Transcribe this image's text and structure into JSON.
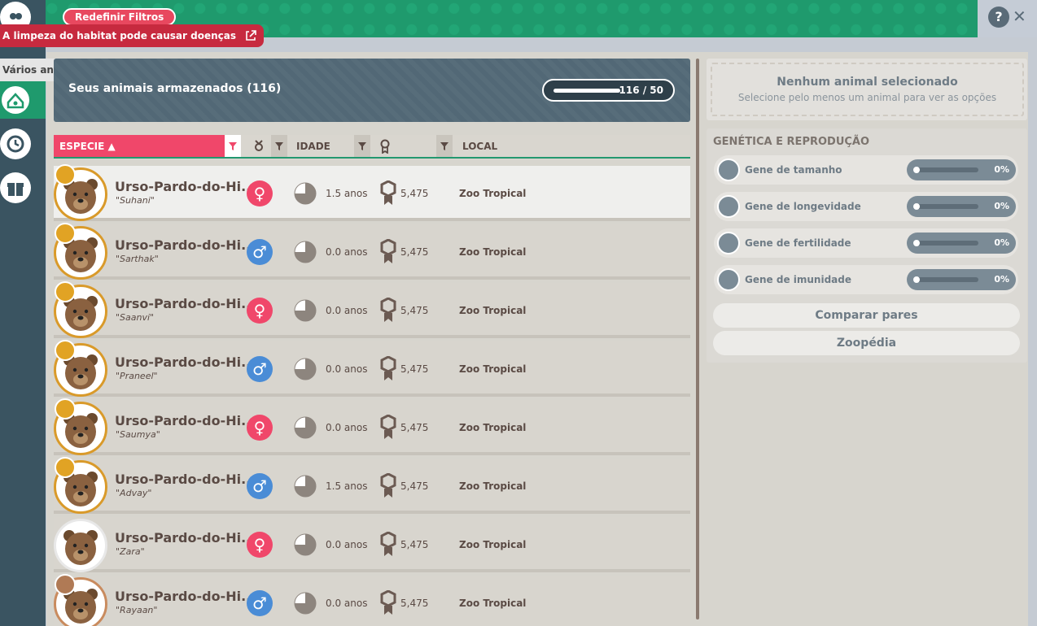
{
  "toolbar": {
    "reset_filters": "Redefinir Filtros",
    "help": "?",
    "close": "✕"
  },
  "notifications": [
    {
      "text": "A limpeza do habitat pode causar doenças",
      "icon": "external-link-icon",
      "severity": "alert"
    },
    {
      "text": "Vários animais estão com bem-estar baixo",
      "icon": "external-link-icon",
      "severity": "info"
    }
  ],
  "storage": {
    "title": "Seus animais armazenados (116)",
    "capacity": "116 / 50"
  },
  "columns": {
    "species": "ESPECIE ▲",
    "age": "IDADE",
    "location": "LOCAL"
  },
  "animals": [
    {
      "name": "Urso-Pardo-do-Hi...",
      "nickname": "\"Suhani\"",
      "gender": "♀",
      "sex": "female",
      "age": "1.5 anos",
      "score": "5,475",
      "location": "Zoo Tropical",
      "medal": "gold",
      "selected": true
    },
    {
      "name": "Urso-Pardo-do-Hi...",
      "nickname": "\"Sarthak\"",
      "gender": "♂",
      "sex": "male",
      "age": "0.0 anos",
      "score": "5,475",
      "location": "Zoo Tropical",
      "medal": "gold"
    },
    {
      "name": "Urso-Pardo-do-Hi...",
      "nickname": "\"Saanvi\"",
      "gender": "♀",
      "sex": "female",
      "age": "0.0 anos",
      "score": "5,475",
      "location": "Zoo Tropical",
      "medal": "gold"
    },
    {
      "name": "Urso-Pardo-do-Hi...",
      "nickname": "\"Praneel\"",
      "gender": "♂",
      "sex": "male",
      "age": "0.0 anos",
      "score": "5,475",
      "location": "Zoo Tropical",
      "medal": "gold"
    },
    {
      "name": "Urso-Pardo-do-Hi...",
      "nickname": "\"Saumya\"",
      "gender": "♀",
      "sex": "female",
      "age": "0.0 anos",
      "score": "5,475",
      "location": "Zoo Tropical",
      "medal": "gold"
    },
    {
      "name": "Urso-Pardo-do-Hi...",
      "nickname": "\"Advay\"",
      "gender": "♂",
      "sex": "male",
      "age": "1.5 anos",
      "score": "5,475",
      "location": "Zoo Tropical",
      "medal": "gold"
    },
    {
      "name": "Urso-Pardo-do-Hi...",
      "nickname": "\"Zara\"",
      "gender": "♀",
      "sex": "female",
      "age": "0.0 anos",
      "score": "5,475",
      "location": "Zoo Tropical",
      "medal": "none"
    },
    {
      "name": "Urso-Pardo-do-Hi...",
      "nickname": "\"Rayaan\"",
      "gender": "♂",
      "sex": "male",
      "age": "0.0 anos",
      "score": "5,475",
      "location": "Zoo Tropical",
      "medal": "bronze"
    }
  ],
  "selection": {
    "title": "Nenhum animal selecionado",
    "subtitle": "Selecione pelo menos um animal para ver as opções"
  },
  "genetics": {
    "title": "GENÉTICA E REPRODUÇÃO",
    "genes": [
      {
        "label": "Gene de tamanho",
        "value": "0%",
        "icon": "size-icon"
      },
      {
        "label": "Gene de longevidade",
        "value": "0%",
        "icon": "longevity-icon"
      },
      {
        "label": "Gene de fertilidade",
        "value": "0%",
        "icon": "fertility-icon"
      },
      {
        "label": "Gene de imunidade",
        "value": "0%",
        "icon": "immunity-icon"
      }
    ]
  },
  "actions": {
    "compare": "Comparar pares",
    "zoopedia": "Zoopédia"
  },
  "colors": {
    "accent_pink": "#f0476a",
    "female": "#f0476a",
    "male": "#4a8cd6",
    "banner_green": "#1f9a6d",
    "gold": "#d99a2a"
  }
}
